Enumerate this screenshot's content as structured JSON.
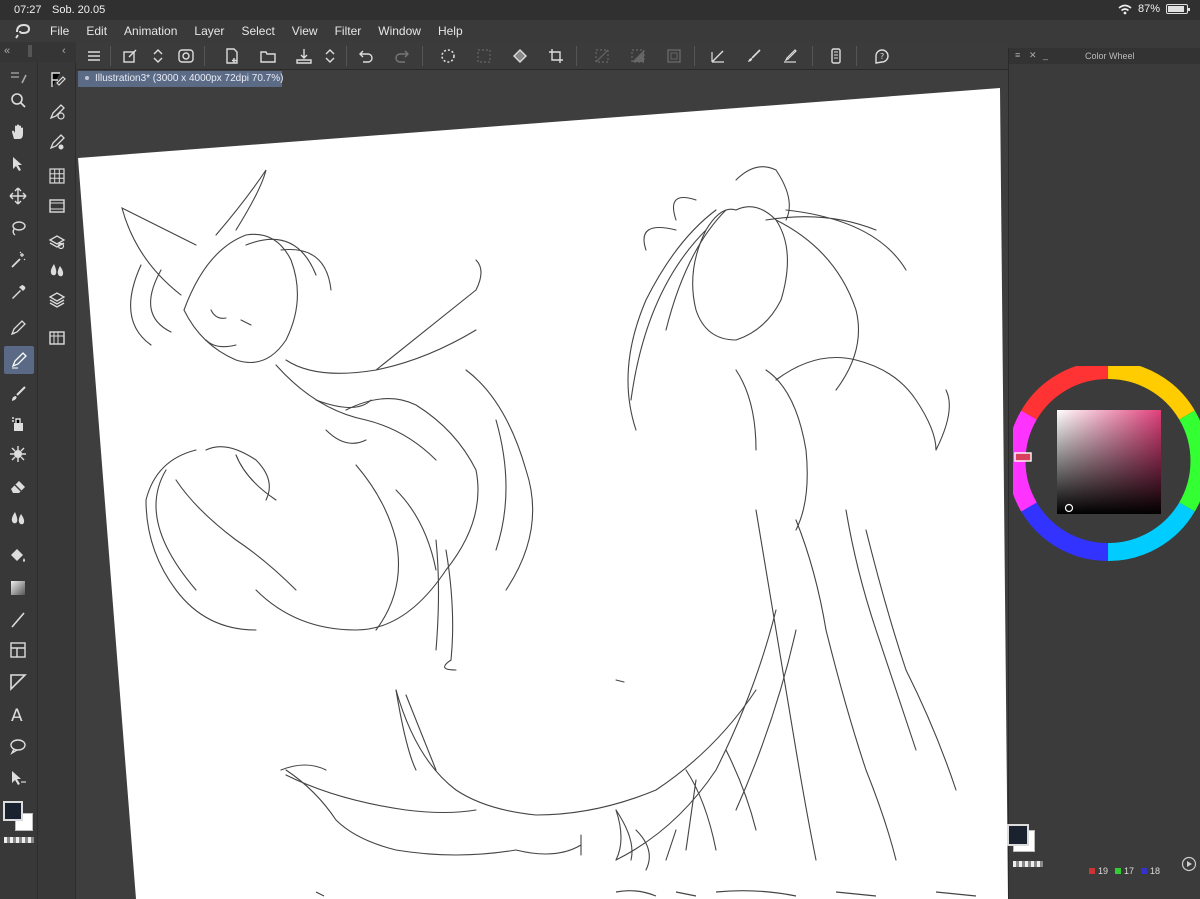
{
  "status": {
    "time": "07:27",
    "date": "Sob. 20.05",
    "battery": "87%"
  },
  "menu": [
    "File",
    "Edit",
    "Animation",
    "Layer",
    "Select",
    "View",
    "Filter",
    "Window",
    "Help"
  ],
  "document": {
    "tab_label": "Illustration3* (3000 x 4000px 72dpi 70.7%)"
  },
  "color_panel": {
    "title": "Color Wheel",
    "r": "19",
    "g": "17",
    "b": "18",
    "accent": "#e0407a",
    "active_tool_bg": "#5a6a86"
  },
  "icons": {
    "toolbar": [
      "menu-icon",
      "transform-icon",
      "stepper-icon",
      "lasso-icon",
      "new-icon",
      "open-icon",
      "save-icon",
      "stepper-icon",
      "undo-icon",
      "redo-icon",
      "spinner-icon",
      "clear-icon",
      "fill-icon",
      "crop-icon",
      "deselect-icon",
      "invert-icon",
      "border-icon",
      "rule-icon",
      "brush-icon",
      "edit-icon",
      "smartphone-icon",
      "help-icon"
    ]
  }
}
